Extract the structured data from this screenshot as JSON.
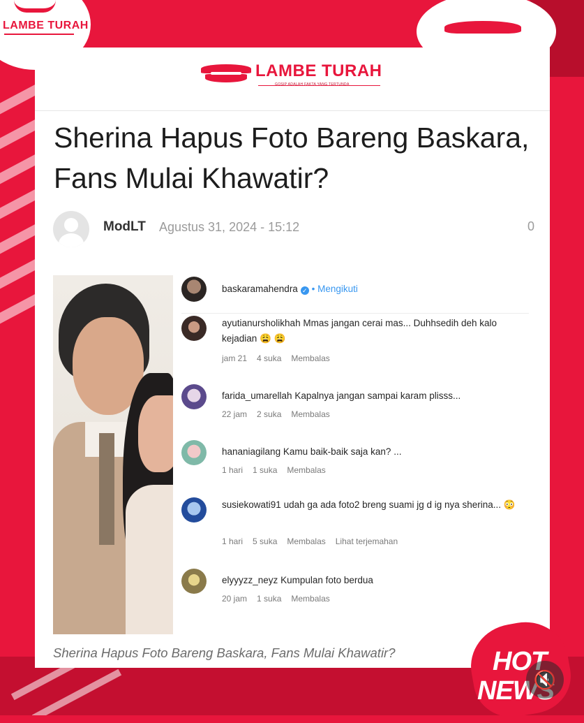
{
  "corner_brand": "LAMBE TURAH",
  "header": {
    "brand": "LAMBE TURAH",
    "tagline": "GOSIP ADALAH FAKTA YANG TERTUNDA"
  },
  "article": {
    "title": "Sherina Hapus Foto Bareng Baskara, Fans Mulai Khawatir?",
    "author": "ModLT",
    "date": "Agustus 31, 2024 - 15:12",
    "comment_count": "0",
    "caption": "Sherina Hapus Foto Bareng Baskara, Fans Mulai Khawatir?"
  },
  "instagram": {
    "owner": {
      "username": "baskaramahendra",
      "follow_label": "Mengikuti"
    },
    "comments": [
      {
        "username": "ayutianursholikhah",
        "text": "Mmas jangan cerai mas... Duhhsedih deh kalo kejadian 😩 😩",
        "time": "jam 21",
        "likes": "4 suka",
        "reply": "Membalas",
        "extra": ""
      },
      {
        "username": "farida_umarellah",
        "text": "Kapalnya jangan sampai karam plisss...",
        "time": "22 jam",
        "likes": "2 suka",
        "reply": "Membalas",
        "extra": ""
      },
      {
        "username": "hananiagilang",
        "text": "Kamu baik-baik saja kan? ...",
        "time": "1 hari",
        "likes": "1 suka",
        "reply": "Membalas",
        "extra": ""
      },
      {
        "username": "susiekowati91",
        "text": "udah ga ada foto2 breng suami jg d ig nya sherina... 😳",
        "time": "1 hari",
        "likes": "5 suka",
        "reply": "Membalas",
        "extra": "Lihat terjemahan"
      },
      {
        "username": "elyyyzz_neyz",
        "text": "Kumpulan foto berdua",
        "time": "20 jam",
        "likes": "1 suka",
        "reply": "Membalas",
        "extra": ""
      }
    ]
  },
  "badge": {
    "line1": "HOT",
    "line2": "NEWS"
  },
  "mute_icon": "speaker-muted-icon",
  "colors": {
    "brand_red": "#e8163c",
    "link_blue": "#3897f0"
  }
}
